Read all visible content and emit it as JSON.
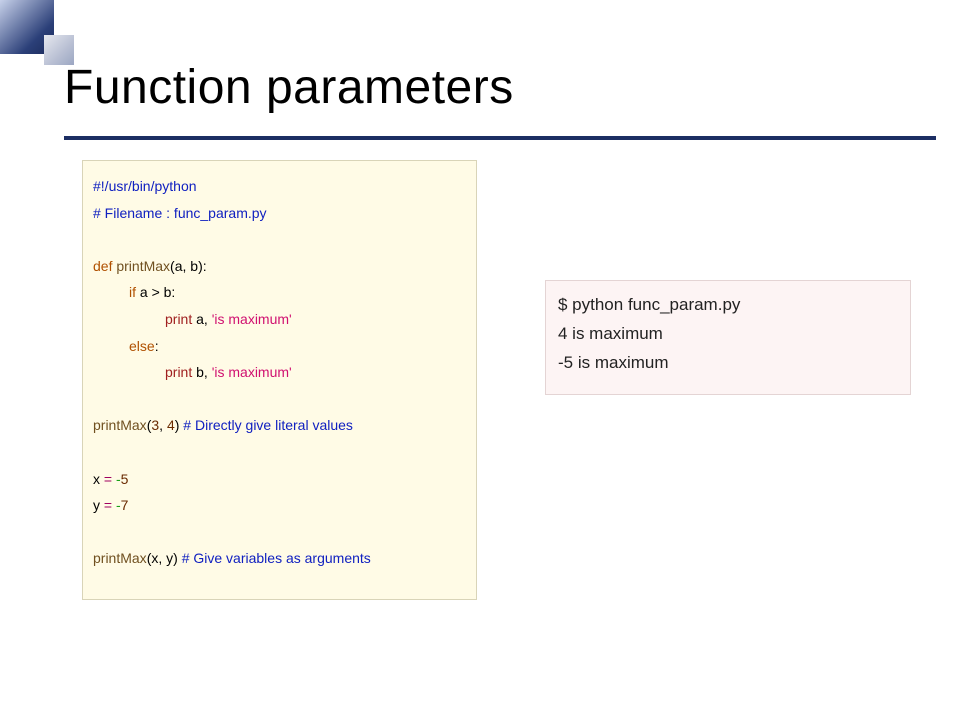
{
  "title": "Function parameters",
  "code": {
    "shebang": "#!/usr/bin/python",
    "filename_comment": "# Filename : func_param.py",
    "def_kw": "def",
    "func_name": "printMax",
    "params_open": "(",
    "param_a": "a",
    "comma_sp": ", ",
    "param_b": "b",
    "params_close": "):",
    "if_kw": "if",
    "if_cond": " a > b:",
    "print_kw": "print",
    "print_a_arg": " a, ",
    "print_b_arg": " b, ",
    "str_max": "'is maximum'",
    "else_kw": "else",
    "else_colon": ":",
    "call1_prefix": "printMax",
    "call1_open": "(",
    "call1_arg1": "3",
    "call1_comma": ", ",
    "call1_arg2": "4",
    "call1_close": ")",
    "call1_comment": " # Directly give literal values",
    "xassign_var": "x",
    "eq": " = ",
    "neg": "-",
    "xval": "5",
    "yassign_var": "y",
    "yval": "7",
    "call2_prefix": "printMax",
    "call2_open": "(",
    "call2_a": "x",
    "call2_comma": ", ",
    "call2_b": "y",
    "call2_close": ")",
    "call2_comment": " # Give variables as arguments"
  },
  "output": {
    "line1": "$ python func_param.py",
    "line2": "4 is maximum",
    "line3": "-5 is maximum"
  }
}
